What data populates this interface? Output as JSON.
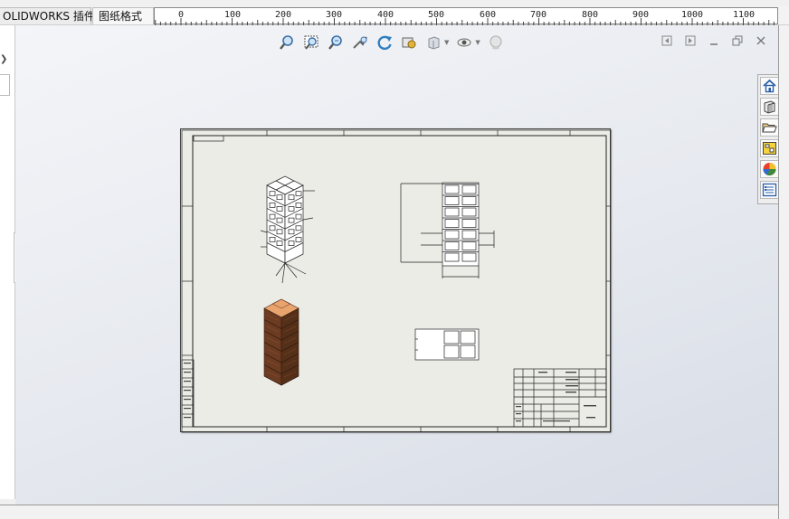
{
  "tabs": [
    {
      "label": "OLIDWORKS 插件"
    },
    {
      "label": "图纸格式"
    }
  ],
  "ruler": {
    "labels": [
      "0",
      "100",
      "200",
      "300",
      "400",
      "500",
      "600",
      "700",
      "800",
      "900",
      "1000",
      "1100"
    ]
  },
  "hud": {
    "icons": [
      "zoom-to-fit-icon",
      "zoom-to-area-icon",
      "zoom-in-out-icon",
      "zoom-to-selection-icon",
      "rotate-icon",
      "pan-icon",
      "display-style-icon",
      "hide-show-items-icon",
      "appearance-icon"
    ]
  },
  "window_controls": [
    "previous-sheet-icon",
    "next-sheet-icon",
    "minimize-icon",
    "restore-icon",
    "close-icon"
  ],
  "taskpane": [
    "home-icon",
    "design-library-icon",
    "file-explorer-icon",
    "view-palette-icon",
    "appearances-icon",
    "custom-properties-icon"
  ],
  "colors": {
    "sheet_bg": "#ecece6",
    "crate_wood": "#6b3b22",
    "crate_top": "#e9a46e",
    "line": "#222222"
  }
}
